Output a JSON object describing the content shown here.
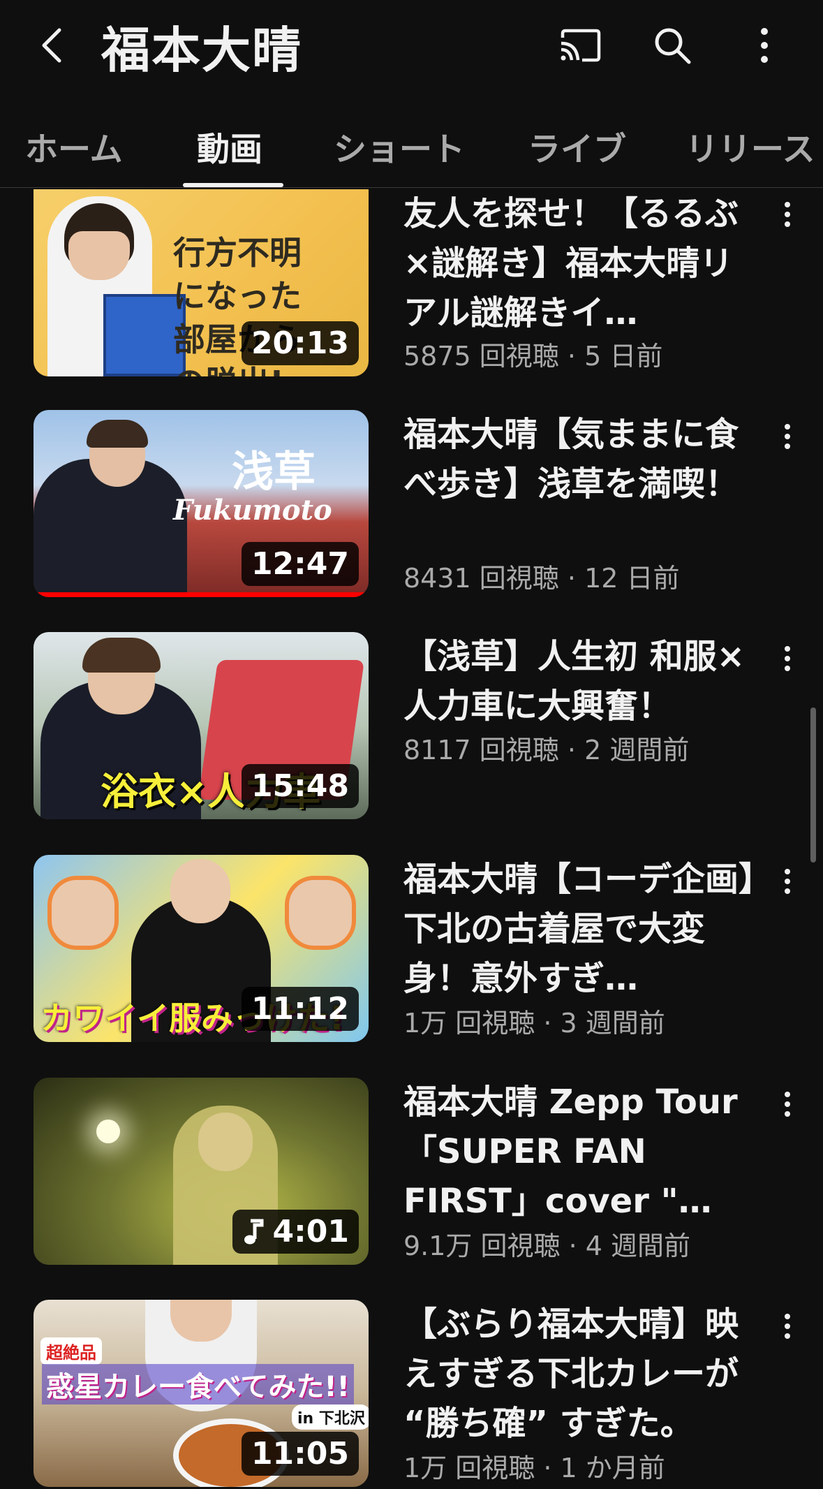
{
  "header": {
    "title": "福本大晴"
  },
  "tabs": [
    {
      "label": "ホーム"
    },
    {
      "label": "動画"
    },
    {
      "label": "ショート"
    },
    {
      "label": "ライブ"
    },
    {
      "label": "リリース"
    }
  ],
  "active_tab": "動画",
  "videos": [
    {
      "title": "友人を探せ！【るるぶ×謎解き】福本大晴リアル謎解きイ…",
      "views": "5875 回視聴",
      "age": "5 日前",
      "duration": "20:13",
      "thumb_text": "行方不明になった部屋からの脱出!"
    },
    {
      "title": "福本大晴【気ままに食べ歩き】浅草を満喫！",
      "views": "8431 回視聴",
      "age": "12 日前",
      "duration": "12:47",
      "watched_fraction": 1.0,
      "thumb_text": "浅草",
      "thumb_sub": "Fukumoto"
    },
    {
      "title": "【浅草】人生初 和服×人力車に大興奮！",
      "views": "8117 回視聴",
      "age": "2 週間前",
      "duration": "15:48",
      "thumb_text": "浴衣×人力車"
    },
    {
      "title": "福本大晴【コーデ企画】下北の古着屋で大変身！意外すぎ…",
      "views": "1万 回視聴",
      "age": "3 週間前",
      "duration": "11:12",
      "thumb_text": "カワイイ服みっけた!"
    },
    {
      "title": "福本大晴 Zepp Tour「SUPER FAN FIRST」cover \"…",
      "views": "9.1万 回視聴",
      "age": "4 週間前",
      "duration": "4:01",
      "music": true
    },
    {
      "title": "【ぶらり福本大晴】映えすぎる下北カレーが “勝ち確” すぎた。",
      "views": "1万 回視聴",
      "age": "1 か月前",
      "duration": "11:05",
      "thumb_text": "惑星カレー食べてみた!!",
      "thumb_badge": "超絶品",
      "thumb_loc": "in 下北沢"
    }
  ],
  "meta_separator": "·",
  "icons": [
    "back-arrow-icon",
    "cast-icon",
    "search-icon",
    "more-vert-icon",
    "music-note-icon"
  ],
  "colors": {
    "background": "#0f0f0f",
    "text": "#f1f1f1",
    "secondary": "#aaaaaa",
    "progress": "#ff0000"
  }
}
